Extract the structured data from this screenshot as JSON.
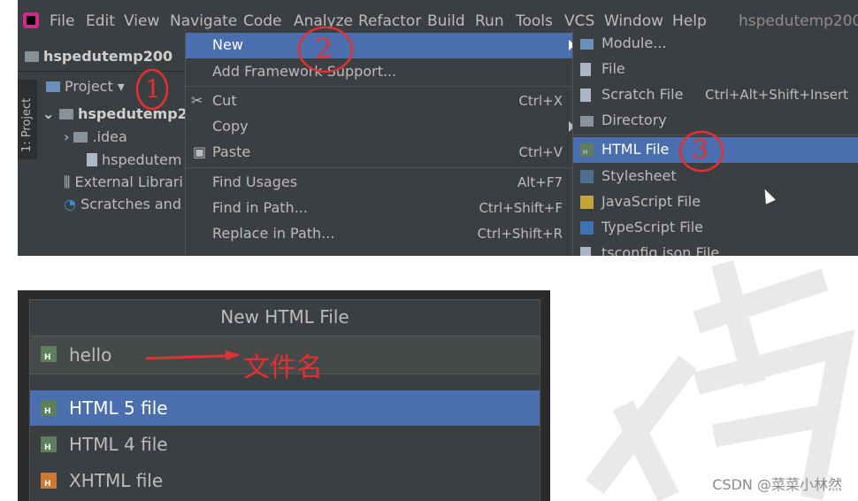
{
  "menubar": {
    "items": [
      "File",
      "Edit",
      "View",
      "Navigate",
      "Code",
      "Analyze",
      "Refactor",
      "Build",
      "Run",
      "Tools",
      "VCS",
      "Window",
      "Help"
    ],
    "project_name": "hspedutemp200"
  },
  "navbar": {
    "project": "hspedutemp200"
  },
  "tool_window": {
    "tab_label": "1: Project",
    "header": "Project"
  },
  "tree": {
    "root": "hspedutemp2",
    "idea": ".idea",
    "file": "hspedutem",
    "external": "External Librari",
    "scratches": "Scratches and"
  },
  "context_menu": {
    "items": [
      {
        "label": "New",
        "shortcut": ""
      },
      {
        "label": "Add Framework Support...",
        "shortcut": ""
      },
      {
        "label": "Cut",
        "shortcut": "Ctrl+X"
      },
      {
        "label": "Copy",
        "shortcut": ""
      },
      {
        "label": "Paste",
        "shortcut": "Ctrl+V"
      },
      {
        "label": "Find Usages",
        "shortcut": "Alt+F7"
      },
      {
        "label": "Find in Path...",
        "shortcut": "Ctrl+Shift+F"
      },
      {
        "label": "Replace in Path...",
        "shortcut": "Ctrl+Shift+R"
      }
    ]
  },
  "submenu": {
    "items": [
      {
        "label": "Module...",
        "shortcut": ""
      },
      {
        "label": "File",
        "shortcut": ""
      },
      {
        "label": "Scratch File",
        "shortcut": "Ctrl+Alt+Shift+Insert"
      },
      {
        "label": "Directory",
        "shortcut": ""
      },
      {
        "label": "HTML File",
        "shortcut": ""
      },
      {
        "label": "Stylesheet",
        "shortcut": ""
      },
      {
        "label": "JavaScript File",
        "shortcut": ""
      },
      {
        "label": "TypeScript File",
        "shortcut": ""
      },
      {
        "label": "tsconfig.json File",
        "shortcut": ""
      }
    ]
  },
  "annotations": {
    "one": "1",
    "two": "2",
    "three": "3",
    "filename_note": "文件名"
  },
  "dialog": {
    "title": "New HTML File",
    "input_value": "hello",
    "options": [
      "HTML 5 file",
      "HTML 4 file",
      "XHTML file"
    ]
  },
  "watermark": {
    "text": "CSDN @菜菜小林然"
  },
  "colors": {
    "selection": "#4b6eaf",
    "ide_bg": "#3c3f41",
    "annotation": "#e23131"
  }
}
